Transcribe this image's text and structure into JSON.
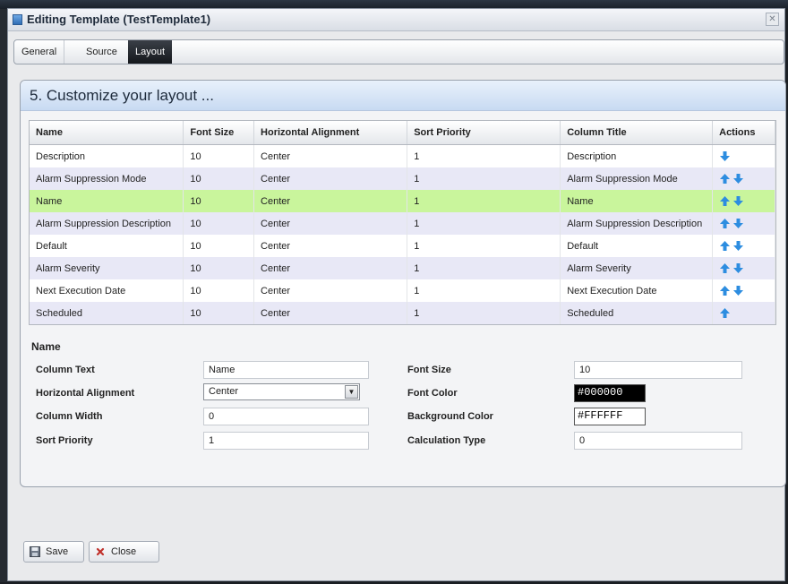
{
  "window": {
    "title": "Editing Template (TestTemplate1)"
  },
  "tabs": [
    {
      "label": "General"
    },
    {
      "label": "Source"
    },
    {
      "label": "Layout"
    }
  ],
  "section_title": "5. Customize your layout ...",
  "table": {
    "headers": [
      "Name",
      "Font Size",
      "Horizontal Alignment",
      "Sort Priority",
      "Column Title",
      "Actions"
    ],
    "rows": [
      {
        "name": "Description",
        "font_size": "10",
        "align": "Center",
        "sort": "1",
        "title": "Description",
        "up": false,
        "down": true
      },
      {
        "name": "Alarm Suppression Mode",
        "font_size": "10",
        "align": "Center",
        "sort": "1",
        "title": "Alarm Suppression Mode",
        "up": true,
        "down": true
      },
      {
        "name": "Name",
        "font_size": "10",
        "align": "Center",
        "sort": "1",
        "title": "Name",
        "up": true,
        "down": true,
        "selected": true
      },
      {
        "name": "Alarm Suppression Description",
        "font_size": "10",
        "align": "Center",
        "sort": "1",
        "title": "Alarm Suppression Description",
        "up": true,
        "down": true
      },
      {
        "name": "Default",
        "font_size": "10",
        "align": "Center",
        "sort": "1",
        "title": "Default",
        "up": true,
        "down": true
      },
      {
        "name": "Alarm Severity",
        "font_size": "10",
        "align": "Center",
        "sort": "1",
        "title": "Alarm Severity",
        "up": true,
        "down": true
      },
      {
        "name": "Next Execution Date",
        "font_size": "10",
        "align": "Center",
        "sort": "1",
        "title": "Next Execution Date",
        "up": true,
        "down": true
      },
      {
        "name": "Scheduled",
        "font_size": "10",
        "align": "Center",
        "sort": "1",
        "title": "Scheduled",
        "up": true,
        "down": false
      }
    ]
  },
  "form": {
    "title": "Name",
    "column_text_label": "Column Text",
    "column_text_value": "Name",
    "halign_label": "Horizontal Alignment",
    "halign_value": "Center",
    "column_width_label": "Column Width",
    "column_width_value": "0",
    "sort_priority_label": "Sort Priority",
    "sort_priority_value": "1",
    "font_size_label": "Font Size",
    "font_size_value": "10",
    "font_color_label": "Font Color",
    "font_color_value": "#000000",
    "bg_color_label": "Background Color",
    "bg_color_value": "#FFFFFF",
    "calc_type_label": "Calculation Type",
    "calc_type_value": "0"
  },
  "buttons": {
    "save": "Save",
    "close": "Close"
  },
  "colors": {
    "selected_row": "#c9f59c",
    "alt_row": "#e8e8f6",
    "arrow": "#2d8de0"
  },
  "icons": {
    "up": "arrow-up-icon",
    "down": "arrow-down-icon",
    "save": "floppy-disk-icon",
    "close": "x-icon"
  }
}
